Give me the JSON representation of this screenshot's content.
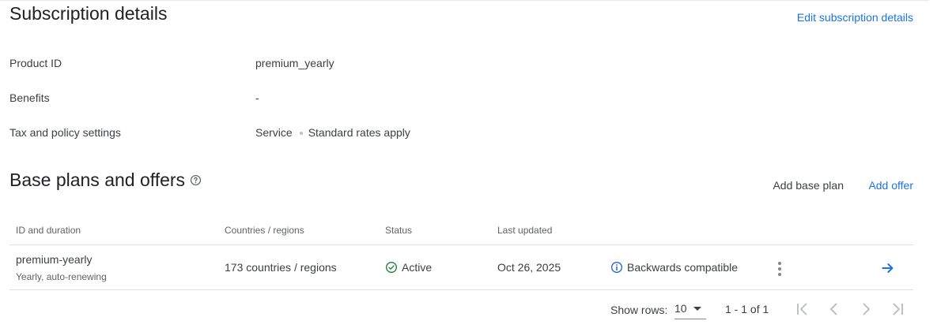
{
  "subscription": {
    "title": "Subscription details",
    "edit_label": "Edit subscription details",
    "fields": [
      {
        "label": "Product ID",
        "value": "premium_yearly"
      },
      {
        "label": "Benefits",
        "value": "-"
      },
      {
        "label": "Tax and policy settings",
        "value_parts": [
          "Service",
          "Standard rates apply"
        ]
      }
    ]
  },
  "base_plans": {
    "title": "Base plans and offers",
    "add_base_plan": "Add base plan",
    "add_offer": "Add offer",
    "columns": [
      "ID and duration",
      "Countries / regions",
      "Status",
      "Last updated"
    ],
    "rows": [
      {
        "id": "premium-yearly",
        "duration": "Yearly, auto-renewing",
        "regions": "173 countries / regions",
        "status": "Active",
        "last_updated": "Oct 26, 2025",
        "compat": "Backwards compatible"
      }
    ]
  },
  "pagination": {
    "show_rows_label": "Show rows:",
    "rows_value": "10",
    "range": "1 - 1 of 1"
  },
  "icons": {
    "help": "help-circle-icon",
    "status": "check-circle-icon",
    "compat": "info-icon",
    "more": "more-vert-icon",
    "open": "arrow-right-icon"
  },
  "colors": {
    "accent": "#1a73e8",
    "active": "#188038",
    "disabled": "#bdc1c6"
  }
}
